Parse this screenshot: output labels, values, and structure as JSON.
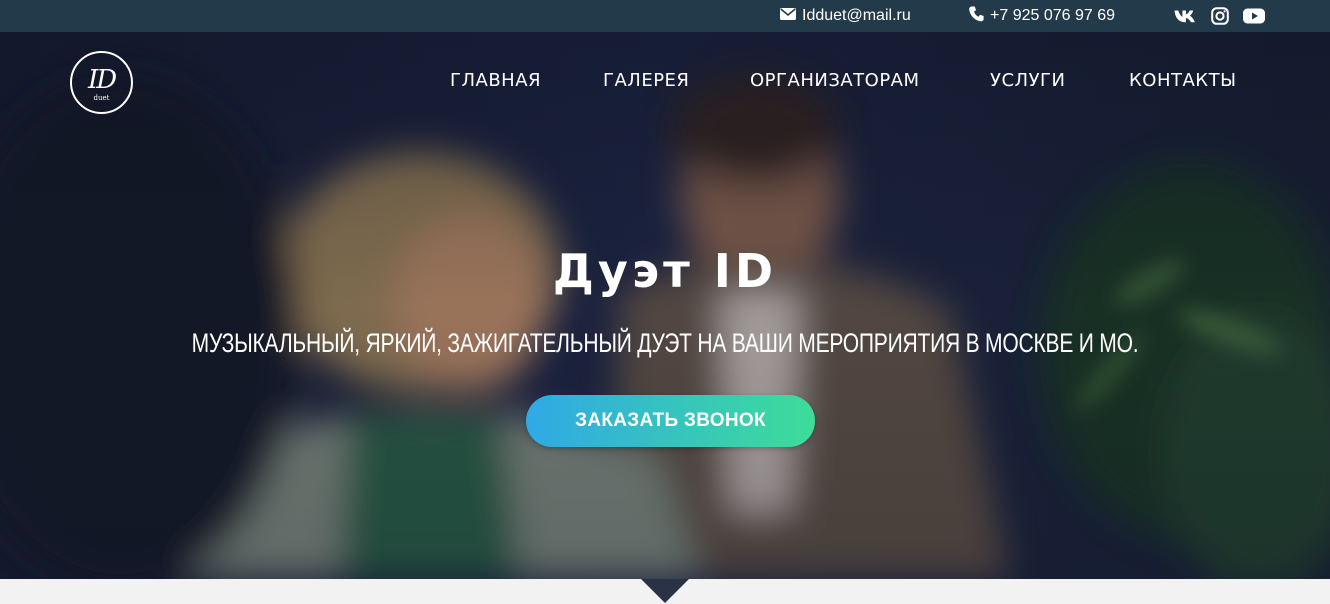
{
  "topbar": {
    "email": "Idduet@mail.ru",
    "phone": "+7 925 076 97 69",
    "icons": {
      "email": "envelope-icon",
      "phone": "phone-icon",
      "social": [
        "vk-icon",
        "instagram-icon",
        "youtube-icon"
      ]
    }
  },
  "logo": {
    "mark": "ID",
    "sub": "duet"
  },
  "nav": {
    "items": [
      "ГЛАВНАЯ",
      "ГАЛЕРЕЯ",
      "ОРГАНИЗАТОРАМ",
      "УСЛУГИ",
      "КОНТАКТЫ"
    ]
  },
  "hero": {
    "title": "Дуэт ID",
    "subtitle": "МУЗЫКАЛЬНЫЙ, ЯРКИЙ, ЗАЖИГАТЕЛЬНЫЙ ДУЭТ НА ВАШИ МЕРОПРИЯТИЯ В МОСКВЕ И МО.",
    "cta_label": "ЗАКАЗАТЬ ЗВОНОК"
  },
  "colors": {
    "topbar_bg": "#233a4b",
    "cta_start": "#2fa9e6",
    "cta_end": "#3ddd98",
    "page_bg": "#f2f2f2"
  }
}
